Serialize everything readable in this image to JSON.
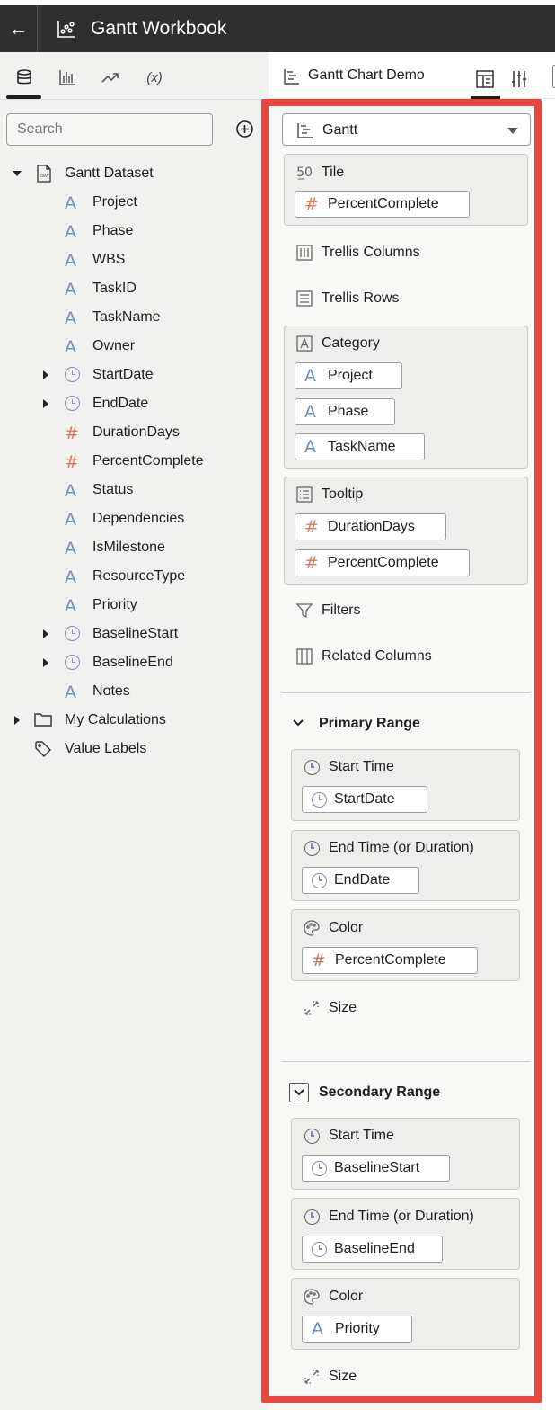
{
  "app": {
    "title": "Gantt Workbook",
    "back_glyph": "←"
  },
  "left_tabs": [
    {
      "name": "data-tab",
      "icon": "database-icon"
    },
    {
      "name": "visualizations-tab",
      "icon": "bar-chart-icon"
    },
    {
      "name": "analytics-tab",
      "icon": "trend-icon"
    },
    {
      "name": "calculations-tab",
      "label": "(x)"
    }
  ],
  "search": {
    "placeholder": "Search"
  },
  "dataset": {
    "name": "Gantt Dataset",
    "columns": [
      {
        "label": "Project",
        "type": "attribute"
      },
      {
        "label": "Phase",
        "type": "attribute"
      },
      {
        "label": "WBS",
        "type": "attribute"
      },
      {
        "label": "TaskID",
        "type": "attribute"
      },
      {
        "label": "TaskName",
        "type": "attribute"
      },
      {
        "label": "Owner",
        "type": "attribute"
      },
      {
        "label": "StartDate",
        "type": "date",
        "expandable": true
      },
      {
        "label": "EndDate",
        "type": "date",
        "expandable": true
      },
      {
        "label": "DurationDays",
        "type": "measure"
      },
      {
        "label": "PercentComplete",
        "type": "measure"
      },
      {
        "label": "Status",
        "type": "attribute"
      },
      {
        "label": "Dependencies",
        "type": "attribute"
      },
      {
        "label": "IsMilestone",
        "type": "attribute"
      },
      {
        "label": "ResourceType",
        "type": "attribute"
      },
      {
        "label": "Priority",
        "type": "attribute"
      },
      {
        "label": "BaselineStart",
        "type": "date",
        "expandable": true
      },
      {
        "label": "BaselineEnd",
        "type": "date",
        "expandable": true
      },
      {
        "label": "Notes",
        "type": "attribute"
      }
    ],
    "extra": [
      {
        "label": "My Calculations"
      },
      {
        "label": "Value Labels"
      }
    ]
  },
  "canvas": {
    "title": "Gantt Chart Demo"
  },
  "grammar": {
    "viz_type": "Gantt",
    "tile": {
      "title": "Tile",
      "pill": "PercentComplete"
    },
    "trellis_columns": "Trellis Columns",
    "trellis_rows": "Trellis Rows",
    "category": {
      "title": "Category",
      "pills": [
        "Project",
        "Phase",
        "TaskName"
      ]
    },
    "tooltip": {
      "title": "Tooltip",
      "pills": [
        "DurationDays",
        "PercentComplete"
      ]
    },
    "filters": "Filters",
    "related_columns": "Related Columns",
    "primary": {
      "title": "Primary Range",
      "start_title": "Start Time",
      "start_pill": "StartDate",
      "end_title": "End Time (or Duration)",
      "end_pill": "EndDate",
      "color_title": "Color",
      "color_pill": "PercentComplete",
      "size": "Size"
    },
    "secondary": {
      "title": "Secondary Range",
      "start_title": "Start Time",
      "start_pill": "BaselineStart",
      "end_title": "End Time (or Duration)",
      "end_pill": "BaselineEnd",
      "color_title": "Color",
      "color_pill": "Priority",
      "size": "Size"
    }
  },
  "colors": {
    "highlight_border": "#e8473f",
    "measure": "#d9775e",
    "attribute": "#6f8fb3",
    "date": "#8e84b5",
    "topbar": "#2f2f2f"
  }
}
